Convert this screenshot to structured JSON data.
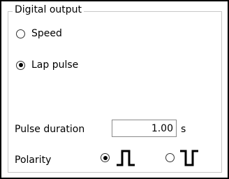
{
  "group": {
    "title": "Digital output"
  },
  "output_mode": {
    "options": [
      {
        "label": "Speed",
        "selected": false
      },
      {
        "label": "Lap pulse",
        "selected": true
      }
    ]
  },
  "pulse_duration": {
    "label": "Pulse duration",
    "value": "1.00",
    "unit": "s"
  },
  "polarity": {
    "label": "Polarity",
    "options": [
      {
        "icon": "positive-pulse-icon",
        "selected": true
      },
      {
        "icon": "negative-pulse-icon",
        "selected": false
      }
    ]
  }
}
